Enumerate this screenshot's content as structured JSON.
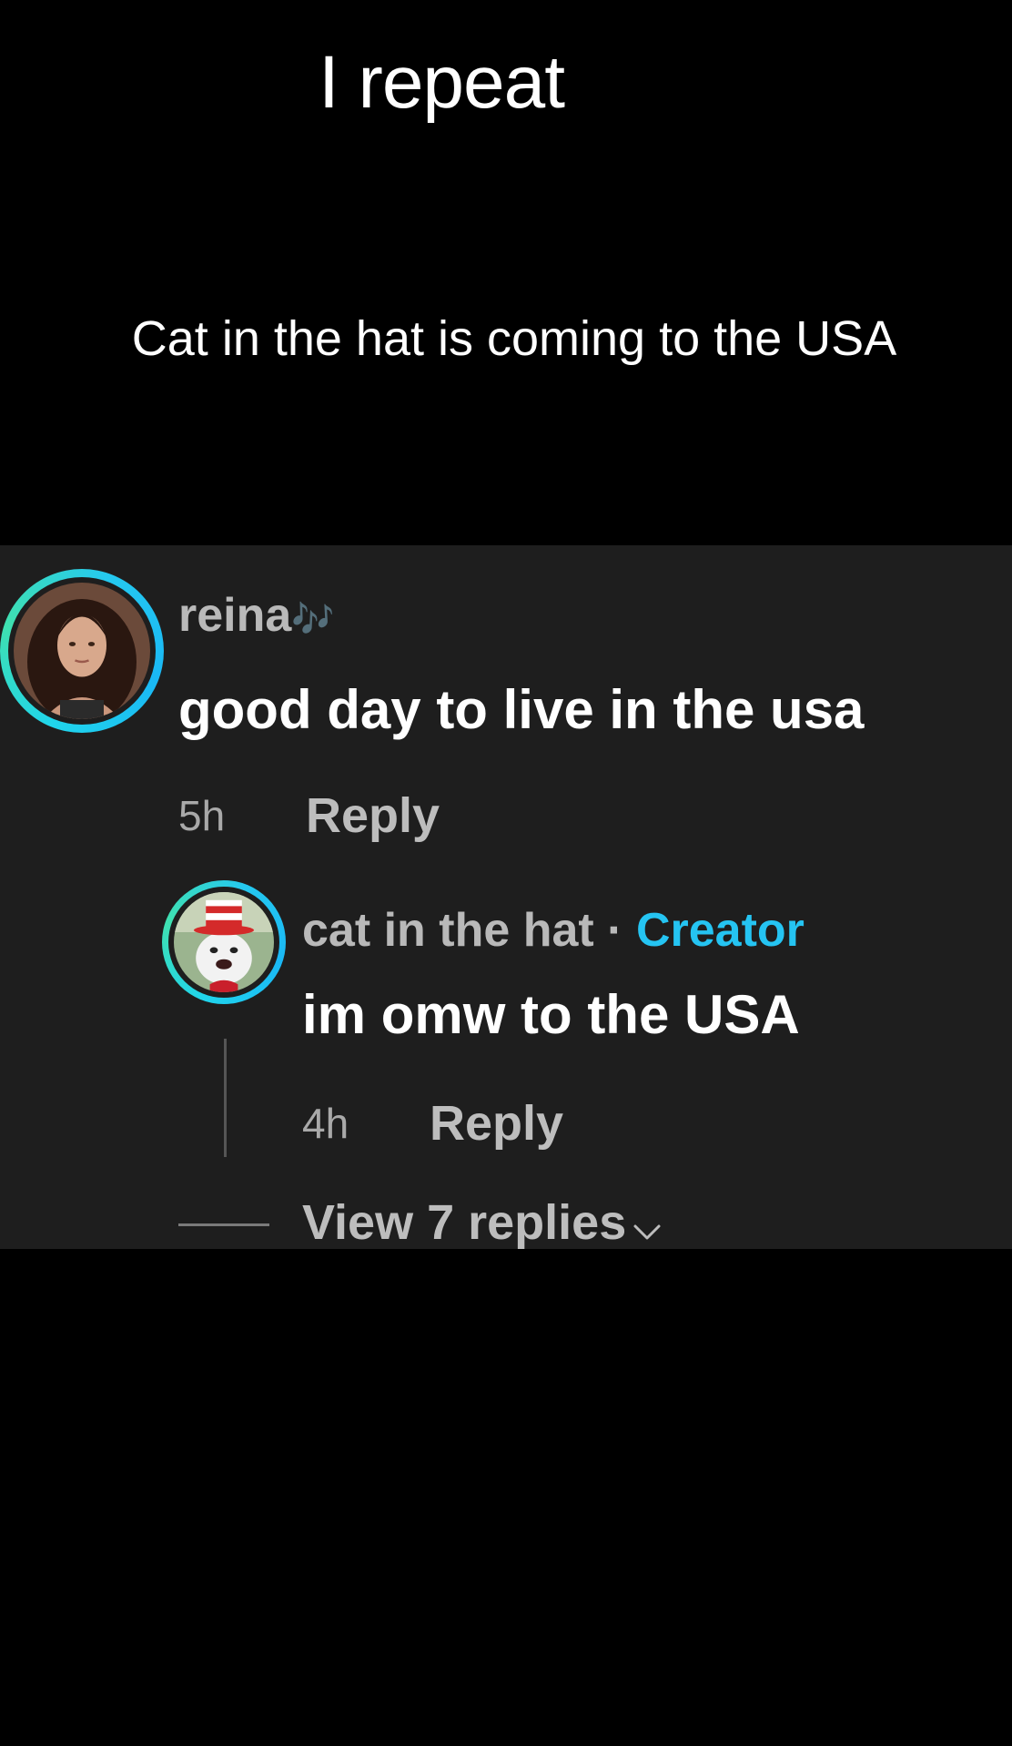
{
  "caption": {
    "title": "I repeat",
    "subtitle": "Cat in the hat is coming to the USA"
  },
  "comment": {
    "username": "reina",
    "username_emoji": "🎶",
    "text": "good day to live in the usa",
    "time": "5h",
    "reply_label": "Reply",
    "avatar_icon": "profile-photo-woman"
  },
  "reply": {
    "username": "cat in the hat",
    "separator": "·",
    "badge": "Creator",
    "text": "im omw to the USA",
    "time": "4h",
    "reply_label": "Reply",
    "avatar_icon": "profile-photo-cat-in-the-hat"
  },
  "view_replies": {
    "label": "View 7 replies",
    "icon": "chevron-down-icon"
  },
  "colors": {
    "background": "#000000",
    "panel": "#1e1e1e",
    "accent_ring": "#20d5ec",
    "creator_badge": "#25c4f2",
    "muted_text": "#b9b9b9"
  }
}
